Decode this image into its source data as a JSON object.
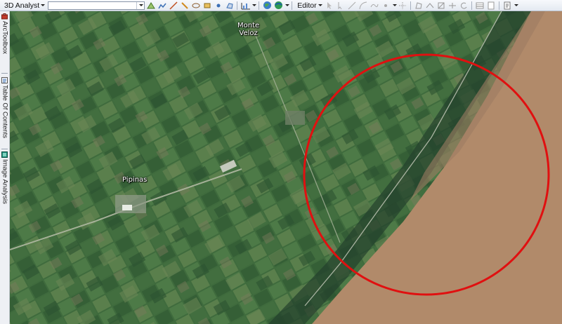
{
  "toolbar": {
    "analyst_label": "3D Analyst",
    "layer_combo_value": "",
    "editor_label": "Editor"
  },
  "dock": {
    "tabs": [
      {
        "label": "ArcToolbox",
        "icon": "toolbox-icon"
      },
      {
        "label": "Table Of Contents",
        "icon": "table-of-contents-icon"
      },
      {
        "label": "Image Analysis",
        "icon": "image-analysis-icon"
      }
    ]
  },
  "map": {
    "places": [
      {
        "name": "Monte\nVeloz"
      },
      {
        "name": "Pipinas"
      }
    ],
    "annotation_color": "#e01010",
    "land_color": "#3e6a3c",
    "water_color": "#b18a6a"
  }
}
